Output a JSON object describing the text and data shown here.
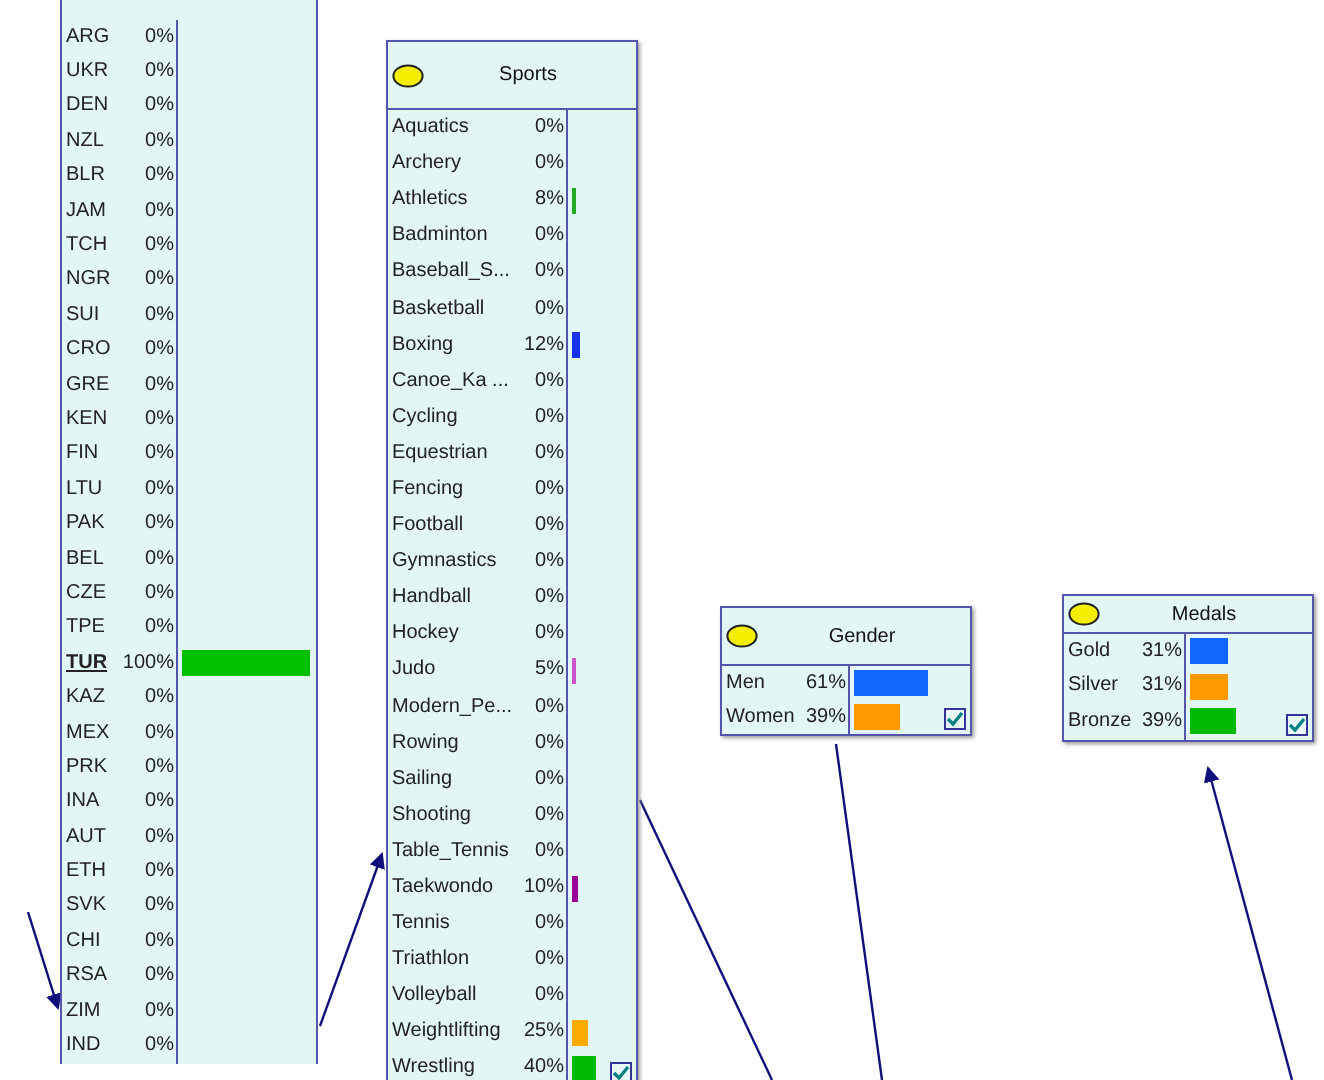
{
  "nodes": [
    {
      "kind": "list",
      "states": [
        {
          "label": "ARG",
          "percent": "0%",
          "selected": false
        },
        {
          "label": "UKR",
          "percent": "0%",
          "selected": false
        },
        {
          "label": "DEN",
          "percent": "0%",
          "selected": false
        },
        {
          "label": "NZL",
          "percent": "0%",
          "selected": false
        },
        {
          "label": "BLR",
          "percent": "0%",
          "selected": false
        },
        {
          "label": "JAM",
          "percent": "0%",
          "selected": false
        },
        {
          "label": "TCH",
          "percent": "0%",
          "selected": false
        },
        {
          "label": "NGR",
          "percent": "0%",
          "selected": false
        },
        {
          "label": "SUI",
          "percent": "0%",
          "selected": false
        },
        {
          "label": "CRO",
          "percent": "0%",
          "selected": false
        },
        {
          "label": "GRE",
          "percent": "0%",
          "selected": false
        },
        {
          "label": "KEN",
          "percent": "0%",
          "selected": false
        },
        {
          "label": "FIN",
          "percent": "0%",
          "selected": false
        },
        {
          "label": "LTU",
          "percent": "0%",
          "selected": false
        },
        {
          "label": "PAK",
          "percent": "0%",
          "selected": false
        },
        {
          "label": "BEL",
          "percent": "0%",
          "selected": false
        },
        {
          "label": "CZE",
          "percent": "0%",
          "selected": false
        },
        {
          "label": "TPE",
          "percent": "0%",
          "selected": false
        },
        {
          "label": "TUR",
          "percent": "100%",
          "selected": true,
          "color": "#00c000"
        },
        {
          "label": "KAZ",
          "percent": "0%",
          "selected": false
        },
        {
          "label": "MEX",
          "percent": "0%",
          "selected": false
        },
        {
          "label": "PRK",
          "percent": "0%",
          "selected": false
        },
        {
          "label": "INA",
          "percent": "0%",
          "selected": false
        },
        {
          "label": "AUT",
          "percent": "0%",
          "selected": false
        },
        {
          "label": "ETH",
          "percent": "0%",
          "selected": false
        },
        {
          "label": "SVK",
          "percent": "0%",
          "selected": false
        },
        {
          "label": "CHI",
          "percent": "0%",
          "selected": false
        },
        {
          "label": "RSA",
          "percent": "0%",
          "selected": false
        },
        {
          "label": "ZIM",
          "percent": "0%",
          "selected": false
        },
        {
          "label": "IND",
          "percent": "0%",
          "selected": false
        }
      ]
    },
    {
      "kind": "node",
      "title": "Sports",
      "states": [
        {
          "label": "Aquatics",
          "percent": "0%"
        },
        {
          "label": "Archery",
          "percent": "0%"
        },
        {
          "label": "Athletics",
          "percent": "8%",
          "color": "#22aa22"
        },
        {
          "label": "Badminton",
          "percent": "0%"
        },
        {
          "label": "Baseball_S...",
          "percent": "0%"
        },
        {
          "label": "Basketball",
          "percent": "0%"
        },
        {
          "label": "Boxing",
          "percent": "12%",
          "color": "#1a33ee"
        },
        {
          "label": "Canoe_Ka ...",
          "percent": "0%"
        },
        {
          "label": "Cycling",
          "percent": "0%"
        },
        {
          "label": "Equestrian",
          "percent": "0%"
        },
        {
          "label": "Fencing",
          "percent": "0%"
        },
        {
          "label": "Football",
          "percent": "0%"
        },
        {
          "label": "Gymnastics",
          "percent": "0%"
        },
        {
          "label": "Handball",
          "percent": "0%"
        },
        {
          "label": "Hockey",
          "percent": "0%"
        },
        {
          "label": "Judo",
          "percent": "5%",
          "color": "#cc55cc"
        },
        {
          "label": "Modern_Pe...",
          "percent": "0%"
        },
        {
          "label": "Rowing",
          "percent": "0%"
        },
        {
          "label": "Sailing",
          "percent": "0%"
        },
        {
          "label": "Shooting",
          "percent": "0%"
        },
        {
          "label": "Table_Tennis",
          "percent": "0%"
        },
        {
          "label": "Taekwondo",
          "percent": "10%",
          "color": "#990099"
        },
        {
          "label": "Tennis",
          "percent": "0%"
        },
        {
          "label": "Triathlon",
          "percent": "0%"
        },
        {
          "label": "Volleyball",
          "percent": "0%"
        },
        {
          "label": "Weightlifting",
          "percent": "25%",
          "color": "#ffaa00"
        },
        {
          "label": "Wrestling",
          "percent": "40%",
          "color": "#00bb00"
        }
      ]
    },
    {
      "kind": "node",
      "title": "Gender",
      "states": [
        {
          "label": "Men",
          "percent": "61%",
          "color": "#1166ff"
        },
        {
          "label": "Women",
          "percent": "39%",
          "color": "#ff9900"
        }
      ]
    },
    {
      "kind": "node",
      "title": "Medals",
      "states": [
        {
          "label": "Gold",
          "percent": "31%",
          "color": "#1166ff"
        },
        {
          "label": "Silver",
          "percent": "31%",
          "color": "#ff9900"
        },
        {
          "label": "Bronze",
          "percent": "39%",
          "color": "#00bb00"
        }
      ]
    }
  ]
}
